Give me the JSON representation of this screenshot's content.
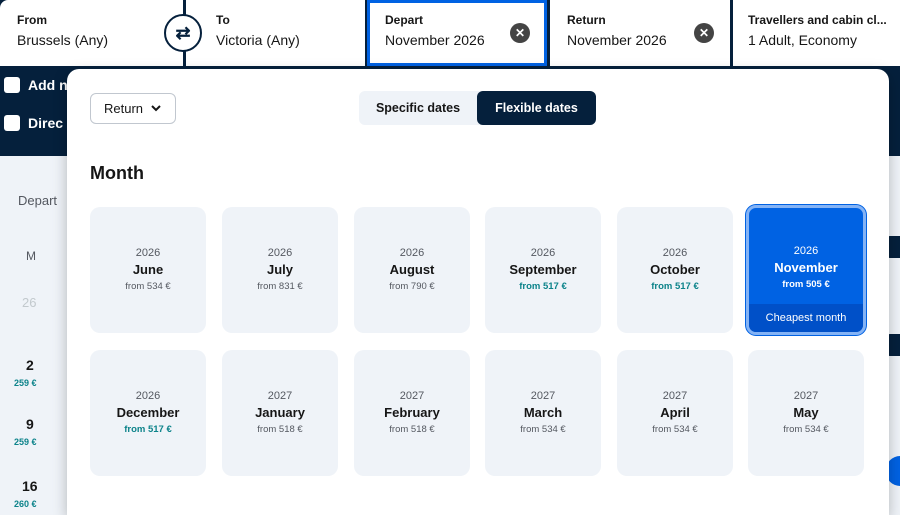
{
  "search": {
    "from": {
      "label": "From",
      "value": "Brussels (Any)"
    },
    "to": {
      "label": "To",
      "value": "Victoria (Any)"
    },
    "depart": {
      "label": "Depart",
      "value": "November 2026"
    },
    "return": {
      "label": "Return",
      "value": "November 2026"
    },
    "travellers": {
      "label": "Travellers and cabin cl...",
      "value": "1 Adult, Economy"
    }
  },
  "background": {
    "add_nearby": "Add n",
    "direct": "Direc",
    "depart_label": "Depart",
    "weekday": "M",
    "prev_day": "26",
    "days": [
      {
        "day": "2",
        "price": "259 €"
      },
      {
        "day": "9",
        "price": "259 €"
      },
      {
        "day": "16",
        "price": "260 €"
      }
    ]
  },
  "dialog": {
    "trip_type": "Return",
    "tab_specific": "Specific dates",
    "tab_flexible": "Flexible dates",
    "month_heading": "Month",
    "months": [
      {
        "year": "2026",
        "month": "June",
        "price": "from 534 €",
        "good": false
      },
      {
        "year": "2026",
        "month": "July",
        "price": "from 831 €",
        "good": false
      },
      {
        "year": "2026",
        "month": "August",
        "price": "from 790 €",
        "good": false
      },
      {
        "year": "2026",
        "month": "September",
        "price": "from 517 €",
        "good": true
      },
      {
        "year": "2026",
        "month": "October",
        "price": "from 517 €",
        "good": true
      },
      {
        "year": "2026",
        "month": "November",
        "price": "from 505 €",
        "good": true,
        "selected": true,
        "badge": "Cheapest month"
      },
      {
        "year": "2026",
        "month": "December",
        "price": "from 517 €",
        "good": true
      },
      {
        "year": "2027",
        "month": "January",
        "price": "from 518 €",
        "good": false
      },
      {
        "year": "2027",
        "month": "February",
        "price": "from 518 €",
        "good": false
      },
      {
        "year": "2027",
        "month": "March",
        "price": "from 534 €",
        "good": false
      },
      {
        "year": "2027",
        "month": "April",
        "price": "from 534 €",
        "good": false
      },
      {
        "year": "2027",
        "month": "May",
        "price": "from 534 €",
        "good": false
      }
    ]
  },
  "colors": {
    "brand_dark": "#05203c",
    "accent": "#0062e3",
    "good_price": "#0c838a"
  },
  "icons": {
    "swap": "swap-arrows-icon",
    "clear": "clear-circle-icon",
    "chevron": "chevron-down-icon"
  }
}
